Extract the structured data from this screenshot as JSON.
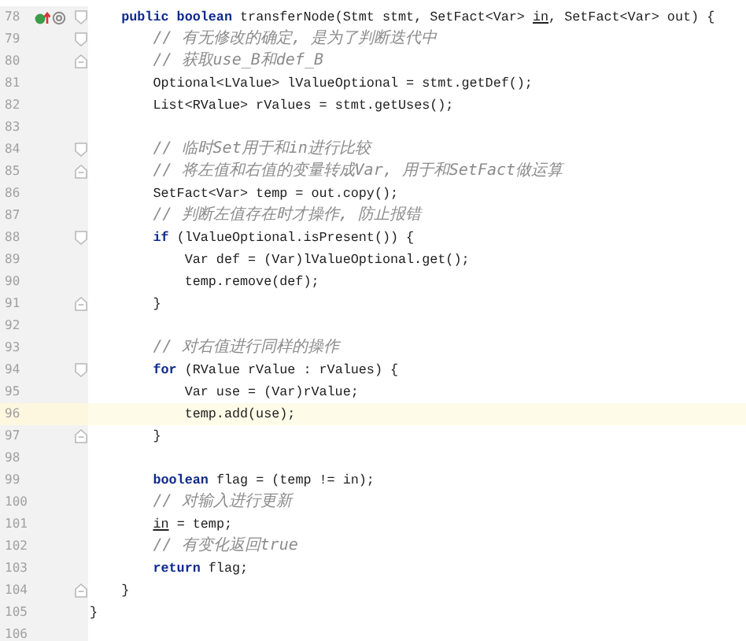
{
  "lines": [
    {
      "number": "78",
      "current": false,
      "fold_marker": {
        "kind": "start"
      },
      "gutter_icons": [
        {
          "kind": "implements"
        },
        {
          "kind": "annotation"
        }
      ],
      "tokens": [
        {
          "kind": "keyword",
          "text": "    public boolean"
        },
        {
          "kind": "plain",
          "text": " transferNode(Stmt stmt, SetFact<Var> "
        },
        {
          "kind": "param",
          "text": "in"
        },
        {
          "kind": "plain",
          "text": ", SetFact<Var> out) {"
        }
      ]
    },
    {
      "number": "79",
      "current": false,
      "fold_marker": {
        "kind": "start"
      },
      "tokens": [
        {
          "kind": "comment",
          "text": "        // 有无修改的确定, 是为了判断迭代中"
        }
      ]
    },
    {
      "number": "80",
      "current": false,
      "fold_marker": {
        "kind": "end"
      },
      "tokens": [
        {
          "kind": "comment",
          "text": "        // 获取use_B和def_B"
        }
      ]
    },
    {
      "number": "81",
      "current": false,
      "tokens": [
        {
          "kind": "plain",
          "text": "        Optional<LValue> lValueOptional = stmt.getDef();"
        }
      ]
    },
    {
      "number": "82",
      "current": false,
      "tokens": [
        {
          "kind": "plain",
          "text": "        List<RValue> rValues = stmt.getUses();"
        }
      ]
    },
    {
      "number": "83",
      "current": false
    },
    {
      "number": "84",
      "current": false,
      "fold_marker": {
        "kind": "start"
      },
      "tokens": [
        {
          "kind": "comment",
          "text": "        // 临时Set用于和in进行比较"
        }
      ]
    },
    {
      "number": "85",
      "current": false,
      "fold_marker": {
        "kind": "end"
      },
      "tokens": [
        {
          "kind": "comment",
          "text": "        // 将左值和右值的变量转成Var, 用于和SetFact做运算"
        }
      ]
    },
    {
      "number": "86",
      "current": false,
      "tokens": [
        {
          "kind": "plain",
          "text": "        SetFact<Var> temp = out.copy();"
        }
      ]
    },
    {
      "number": "87",
      "current": false,
      "tokens": [
        {
          "kind": "comment",
          "text": "        // 判断左值存在时才操作, 防止报错"
        }
      ]
    },
    {
      "number": "88",
      "current": false,
      "fold_marker": {
        "kind": "start"
      },
      "tokens": [
        {
          "kind": "keyword",
          "text": "        if"
        },
        {
          "kind": "plain",
          "text": " (lValueOptional.isPresent()) {"
        }
      ]
    },
    {
      "number": "89",
      "current": false,
      "tokens": [
        {
          "kind": "plain",
          "text": "            Var def = (Var)lValueOptional.get();"
        }
      ]
    },
    {
      "number": "90",
      "current": false,
      "tokens": [
        {
          "kind": "plain",
          "text": "            temp.remove(def);"
        }
      ]
    },
    {
      "number": "91",
      "current": false,
      "fold_marker": {
        "kind": "end"
      },
      "tokens": [
        {
          "kind": "plain",
          "text": "        }"
        }
      ]
    },
    {
      "number": "92",
      "current": false
    },
    {
      "number": "93",
      "current": false,
      "tokens": [
        {
          "kind": "comment",
          "text": "        // 对右值进行同样的操作"
        }
      ]
    },
    {
      "number": "94",
      "current": false,
      "fold_marker": {
        "kind": "start"
      },
      "tokens": [
        {
          "kind": "keyword",
          "text": "        for"
        },
        {
          "kind": "plain",
          "text": " (RValue rValue : rValues) {"
        }
      ]
    },
    {
      "number": "95",
      "current": false,
      "tokens": [
        {
          "kind": "plain",
          "text": "            Var use = (Var)rValue;"
        }
      ]
    },
    {
      "number": "96",
      "current": true,
      "tokens": [
        {
          "kind": "plain",
          "text": "            temp.add(use);"
        }
      ]
    },
    {
      "number": "97",
      "current": false,
      "fold_marker": {
        "kind": "end"
      },
      "tokens": [
        {
          "kind": "plain",
          "text": "        }"
        }
      ]
    },
    {
      "number": "98",
      "current": false
    },
    {
      "number": "99",
      "current": false,
      "tokens": [
        {
          "kind": "keyword",
          "text": "        boolean"
        },
        {
          "kind": "plain",
          "text": " flag = (temp != in);"
        }
      ]
    },
    {
      "number": "100",
      "current": false,
      "tokens": [
        {
          "kind": "comment",
          "text": "        // 对输入进行更新"
        }
      ]
    },
    {
      "number": "101",
      "current": false,
      "tokens": [
        {
          "kind": "param",
          "text": "        in"
        },
        {
          "kind": "plain",
          "text": " = temp;"
        }
      ]
    },
    {
      "number": "102",
      "current": false,
      "tokens": [
        {
          "kind": "comment",
          "text": "        // 有变化返回true"
        }
      ]
    },
    {
      "number": "103",
      "current": false,
      "tokens": [
        {
          "kind": "keyword",
          "text": "        return"
        },
        {
          "kind": "plain",
          "text": " flag;"
        }
      ]
    },
    {
      "number": "104",
      "current": false,
      "fold_marker": {
        "kind": "end"
      },
      "tokens": [
        {
          "kind": "plain",
          "text": "    }"
        }
      ]
    },
    {
      "number": "105",
      "current": false,
      "tokens": [
        {
          "kind": "plain",
          "text": "}"
        }
      ]
    },
    {
      "number": "106",
      "current": false
    }
  ]
}
